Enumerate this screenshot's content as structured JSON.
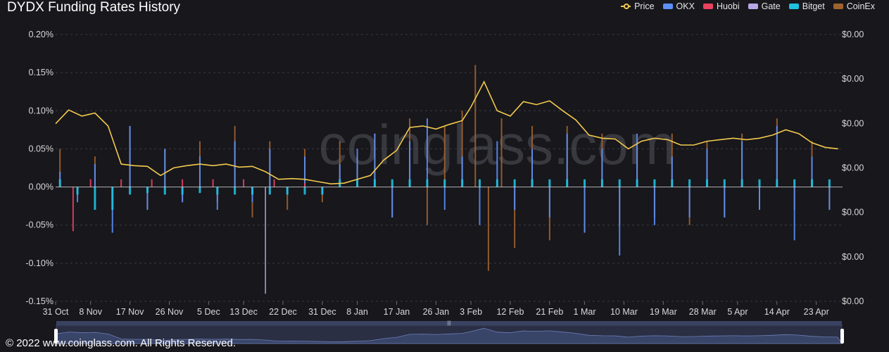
{
  "chart_data": {
    "type": "bar",
    "title": "DYDX Funding Rates History",
    "legend": [
      "Price",
      "OKX",
      "Huobi",
      "Gate",
      "Bitget",
      "CoinEx"
    ],
    "legend_placement": "top-right",
    "x_tick_labels": [
      "31 Oct",
      "8 Nov",
      "17 Nov",
      "26 Nov",
      "5 Dec",
      "13 Dec",
      "22 Dec",
      "31 Dec",
      "8 Jan",
      "17 Jan",
      "26 Jan",
      "3 Feb",
      "12 Feb",
      "21 Feb",
      "1 Mar",
      "10 Mar",
      "19 Mar",
      "28 Mar",
      "5 Apr",
      "14 Apr",
      "23 Apr"
    ],
    "y_left_ticks": [
      "0.20%",
      "0.15%",
      "0.10%",
      "0.05%",
      "0.00%",
      "-0.05%",
      "-0.10%",
      "-0.15%"
    ],
    "y_right_ticks": [
      "$0.00",
      "$0.00",
      "$0.00",
      "$0.00",
      "$0.00",
      "$0.00",
      "$0.00"
    ],
    "ylim_left_percent": [
      -0.15,
      0.2
    ],
    "series": [
      {
        "name": "Price",
        "chart_type": "line",
        "color": "#f2c94c",
        "note": "values read in left-axis percent units",
        "x": [
          "31 Oct",
          "3 Nov",
          "6 Nov",
          "9 Nov",
          "12 Nov",
          "15 Nov",
          "18 Nov",
          "21 Nov",
          "24 Nov",
          "27 Nov",
          "30 Nov",
          "3 Dec",
          "6 Dec",
          "9 Dec",
          "12 Dec",
          "15 Dec",
          "18 Dec",
          "21 Dec",
          "24 Dec",
          "27 Dec",
          "30 Dec",
          "2 Jan",
          "5 Jan",
          "8 Jan",
          "11 Jan",
          "14 Jan",
          "17 Jan",
          "20 Jan",
          "23 Jan",
          "26 Jan",
          "29 Jan",
          "1 Feb",
          "3 Feb",
          "6 Feb",
          "9 Feb",
          "12 Feb",
          "15 Feb",
          "18 Feb",
          "21 Feb",
          "24 Feb",
          "27 Feb",
          "2 Mar",
          "5 Mar",
          "8 Mar",
          "11 Mar",
          "14 Mar",
          "17 Mar",
          "20 Mar",
          "23 Mar",
          "26 Mar",
          "29 Mar",
          "1 Apr",
          "4 Apr",
          "7 Apr",
          "10 Apr",
          "13 Apr",
          "16 Apr",
          "19 Apr",
          "22 Apr",
          "25 Apr",
          "28 Apr"
        ],
        "values": [
          0.083,
          0.101,
          0.093,
          0.097,
          0.08,
          0.03,
          0.028,
          0.027,
          0.015,
          0.025,
          0.028,
          0.03,
          0.028,
          0.03,
          0.026,
          0.027,
          0.02,
          0.01,
          0.011,
          0.01,
          0.007,
          0.004,
          0.005,
          0.01,
          0.015,
          0.035,
          0.048,
          0.078,
          0.08,
          0.076,
          0.082,
          0.087,
          0.105,
          0.138,
          0.1,
          0.093,
          0.112,
          0.108,
          0.113,
          0.1,
          0.088,
          0.068,
          0.064,
          0.063,
          0.05,
          0.06,
          0.064,
          0.062,
          0.055,
          0.055,
          0.06,
          0.062,
          0.064,
          0.062,
          0.064,
          0.068,
          0.075,
          0.07,
          0.058,
          0.052,
          0.05
        ]
      },
      {
        "name": "OKX",
        "chart_type": "bar",
        "color": "#5b8ff9",
        "x": [
          "1 Nov",
          "5 Nov",
          "9 Nov",
          "13 Nov",
          "17 Nov",
          "21 Nov",
          "25 Nov",
          "29 Nov",
          "3 Dec",
          "7 Dec",
          "11 Dec",
          "15 Dec",
          "19 Dec",
          "23 Dec",
          "27 Dec",
          "31 Dec",
          "4 Jan",
          "8 Jan",
          "12 Jan",
          "16 Jan",
          "20 Jan",
          "24 Jan",
          "28 Jan",
          "1 Feb",
          "5 Feb",
          "9 Feb",
          "13 Feb",
          "17 Feb",
          "21 Feb",
          "25 Feb",
          "1 Mar",
          "5 Mar",
          "9 Mar",
          "13 Mar",
          "17 Mar",
          "21 Mar",
          "25 Mar",
          "29 Mar",
          "2 Apr",
          "6 Apr",
          "10 Apr",
          "14 Apr",
          "18 Apr",
          "22 Apr",
          "26 Apr"
        ],
        "values": [
          0.02,
          -0.02,
          0.03,
          -0.06,
          0.08,
          -0.03,
          0.05,
          -0.02,
          0.04,
          -0.03,
          0.06,
          -0.02,
          0.05,
          -0.01,
          0.04,
          -0.01,
          0.03,
          0.05,
          0.07,
          -0.04,
          0.06,
          0.09,
          -0.03,
          0.04,
          -0.05,
          0.06,
          -0.03,
          0.05,
          -0.04,
          0.07,
          -0.06,
          0.05,
          -0.09,
          0.07,
          -0.05,
          0.04,
          -0.04,
          0.05,
          -0.04,
          0.06,
          -0.03,
          0.08,
          -0.07,
          0.04,
          -0.03
        ]
      },
      {
        "name": "Huobi",
        "chart_type": "bar",
        "color": "#e8425f",
        "x": [
          "1 Nov",
          "4 Nov",
          "8 Nov",
          "15 Nov",
          "22 Nov",
          "29 Nov",
          "6 Dec",
          "13 Dec",
          "20 Dec",
          "27 Dec"
        ],
        "values": [
          0.01,
          -0.058,
          0.01,
          0.01,
          0.01,
          0.01,
          0.01,
          0.01,
          0.01,
          0.005
        ]
      },
      {
        "name": "Gate",
        "chart_type": "bar",
        "color": "#b8a7e6",
        "x": [
          "18 Dec"
        ],
        "values": [
          -0.14
        ]
      },
      {
        "name": "Bitget",
        "chart_type": "bar",
        "color": "#1fc1e0",
        "x": [
          "1 Nov",
          "5 Nov",
          "9 Nov",
          "13 Nov",
          "17 Nov",
          "21 Nov",
          "25 Nov",
          "29 Nov",
          "3 Dec",
          "7 Dec",
          "11 Dec",
          "15 Dec",
          "19 Dec",
          "23 Dec",
          "27 Dec",
          "31 Dec",
          "4 Jan",
          "8 Jan",
          "12 Jan",
          "16 Jan",
          "20 Jan",
          "24 Jan",
          "28 Jan",
          "1 Feb",
          "5 Feb",
          "9 Feb",
          "13 Feb",
          "17 Feb",
          "21 Feb",
          "25 Feb",
          "1 Mar",
          "5 Mar",
          "9 Mar",
          "13 Mar",
          "17 Mar",
          "21 Mar",
          "25 Mar",
          "29 Mar",
          "2 Apr",
          "6 Apr",
          "10 Apr",
          "14 Apr",
          "18 Apr",
          "22 Apr",
          "26 Apr"
        ],
        "values": [
          0.01,
          -0.01,
          -0.03,
          -0.03,
          -0.01,
          -0.008,
          -0.01,
          -0.01,
          -0.008,
          -0.01,
          -0.01,
          -0.01,
          -0.01,
          -0.01,
          -0.01,
          -0.01,
          0.01,
          0.01,
          0.01,
          0.01,
          0.01,
          0.01,
          0.01,
          0.01,
          0.01,
          0.01,
          0.01,
          0.01,
          0.01,
          0.01,
          0.01,
          0.01,
          0.01,
          0.01,
          0.01,
          0.01,
          0.01,
          0.01,
          0.01,
          0.01,
          0.01,
          0.01,
          0.01,
          0.01,
          0.01
        ]
      },
      {
        "name": "CoinEx",
        "chart_type": "bar",
        "color": "#a0622d",
        "x": [
          "1 Nov",
          "5 Nov",
          "9 Nov",
          "13 Nov",
          "17 Nov",
          "21 Nov",
          "25 Nov",
          "29 Nov",
          "3 Dec",
          "7 Dec",
          "11 Dec",
          "15 Dec",
          "19 Dec",
          "23 Dec",
          "27 Dec",
          "31 Dec",
          "4 Jan",
          "8 Jan",
          "12 Jan",
          "16 Jan",
          "20 Jan",
          "24 Jan",
          "28 Jan",
          "1 Feb",
          "4 Feb",
          "7 Feb",
          "10 Feb",
          "13 Feb",
          "17 Feb",
          "21 Feb",
          "25 Feb",
          "1 Mar",
          "5 Mar",
          "9 Mar",
          "13 Mar",
          "17 Mar",
          "21 Mar",
          "25 Mar",
          "29 Mar",
          "2 Apr",
          "6 Apr",
          "10 Apr",
          "14 Apr",
          "18 Apr",
          "22 Apr",
          "26 Apr"
        ],
        "values": [
          0.05,
          -0.01,
          0.04,
          -0.02,
          0.08,
          -0.03,
          0.05,
          -0.02,
          0.06,
          -0.02,
          0.08,
          -0.04,
          0.06,
          -0.03,
          0.05,
          -0.02,
          0.06,
          0.04,
          0.07,
          -0.04,
          0.09,
          -0.05,
          0.08,
          0.1,
          0.16,
          -0.11,
          0.09,
          -0.08,
          0.08,
          -0.07,
          0.08,
          -0.06,
          0.07,
          -0.05,
          0.06,
          -0.04,
          0.07,
          -0.05,
          0.06,
          -0.04,
          0.07,
          -0.03,
          0.09,
          -0.03,
          0.06,
          -0.03
        ]
      }
    ]
  },
  "watermark": "coinglass.com",
  "footer": {
    "copyright": "© 2022 www.coinglass.com. All Rights Reserved."
  }
}
